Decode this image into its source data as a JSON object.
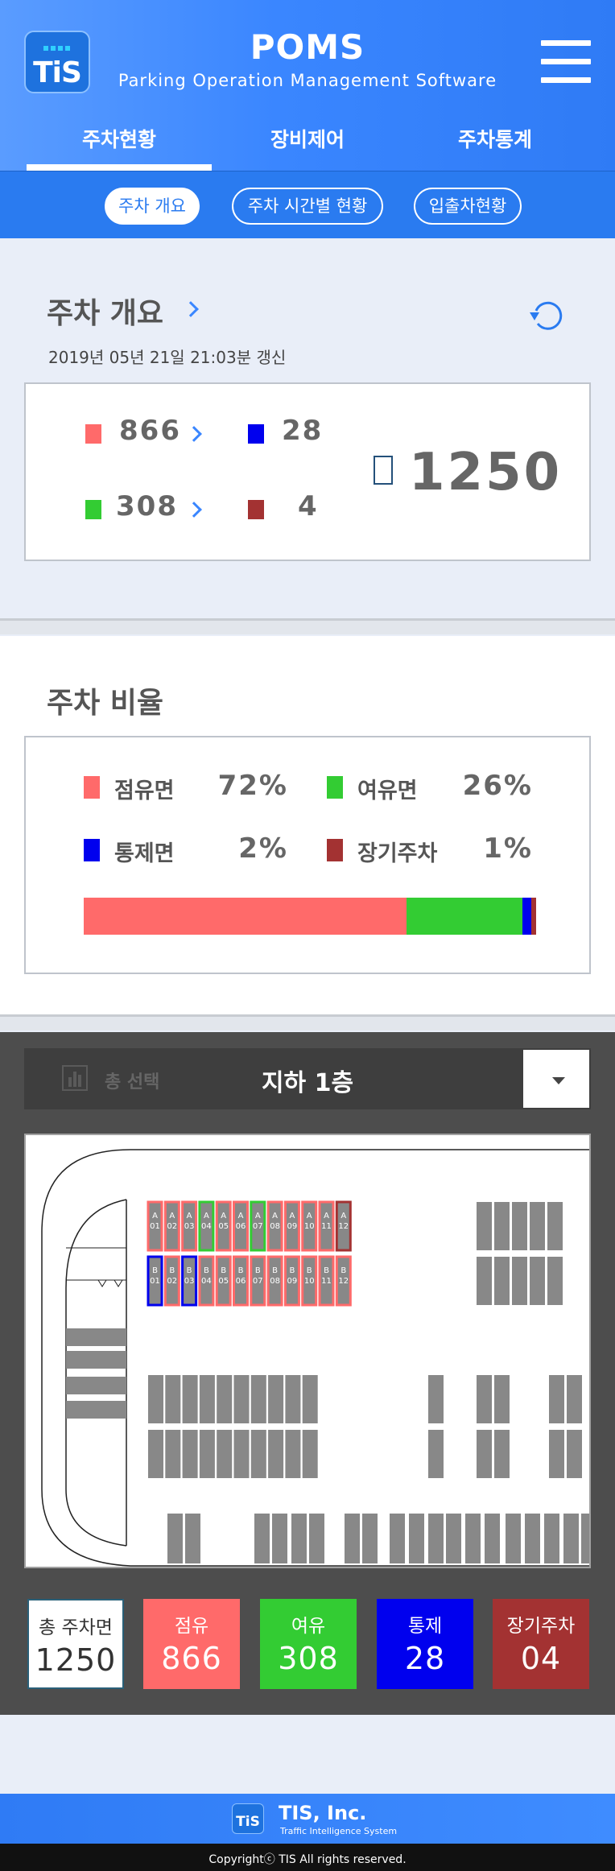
{
  "header": {
    "logo_text": "TiS",
    "title": "POMS",
    "subtitle": "Parking Operation Management Software",
    "menu_icon": "hamburger-menu-icon"
  },
  "main_tabs": [
    {
      "label": "주차현황",
      "active": true
    },
    {
      "label": "장비제어",
      "active": false
    },
    {
      "label": "주차통계",
      "active": false
    }
  ],
  "sub_tabs": [
    {
      "label": "주차 개요",
      "active": true
    },
    {
      "label": "주차 시간별 현황",
      "active": false
    },
    {
      "label": "입출차현황",
      "active": false
    }
  ],
  "overview": {
    "title": "주차 개요",
    "updated": "2019년 05년 21일 21:03분 갱신",
    "occupied": "866",
    "controlled": "28",
    "available": "308",
    "long_term": "4",
    "total": "1250",
    "refresh_icon": "refresh-icon"
  },
  "ratio": {
    "title": "주차 비율",
    "items": [
      {
        "label": "점유면",
        "pct_text": "72%",
        "value": 72,
        "color": "#ff6a6a"
      },
      {
        "label": "여유면",
        "pct_text": "26%",
        "value": 26,
        "color": "#33cc33"
      },
      {
        "label": "통제면",
        "pct_text": "2%",
        "value": 2,
        "color": "#0000ee"
      },
      {
        "label": "장기주차",
        "pct_text": "1%",
        "value": 1,
        "color": "#a33232"
      }
    ]
  },
  "floor": {
    "select_all": "총 선택",
    "name": "지하 1층",
    "row_a": [
      "01",
      "02",
      "03",
      "04",
      "05",
      "06",
      "07",
      "08",
      "09",
      "10",
      "11",
      "12"
    ],
    "row_b": [
      "01",
      "02",
      "03",
      "04",
      "05",
      "06",
      "07",
      "08",
      "09",
      "10",
      "11",
      "12"
    ],
    "row_a_prefix": "A",
    "row_b_prefix": "B",
    "row_a_status": [
      "o",
      "o",
      "o",
      "a",
      "o",
      "o",
      "a",
      "o",
      "o",
      "o",
      "o",
      "l"
    ],
    "row_b_status": [
      "c",
      "o",
      "c",
      "o",
      "o",
      "o",
      "o",
      "o",
      "o",
      "o",
      "o",
      "o"
    ]
  },
  "stats": [
    {
      "label": "총 주차면",
      "value": "1250",
      "bg": "#ffffff",
      "fg": "#333333"
    },
    {
      "label": "점유",
      "value": "866",
      "bg": "#ff6a6a",
      "fg": "#ffffff"
    },
    {
      "label": "여유",
      "value": "308",
      "bg": "#33cc33",
      "fg": "#ffffff"
    },
    {
      "label": "통제",
      "value": "28",
      "bg": "#0000ee",
      "fg": "#ffffff"
    },
    {
      "label": "장기주차",
      "value": "04",
      "bg": "#a33232",
      "fg": "#ffffff"
    }
  ],
  "footer": {
    "logo_text": "TiS",
    "company": "TIS, Inc.",
    "tagline": "Traffic Intelligence System",
    "copyright": "Copyrightⓒ TIS All rights reserved."
  },
  "colors": {
    "occupied": "#ff6a6a",
    "available": "#33cc33",
    "controlled": "#0000ee",
    "long_term": "#a33232",
    "accent": "#3a86ff"
  }
}
